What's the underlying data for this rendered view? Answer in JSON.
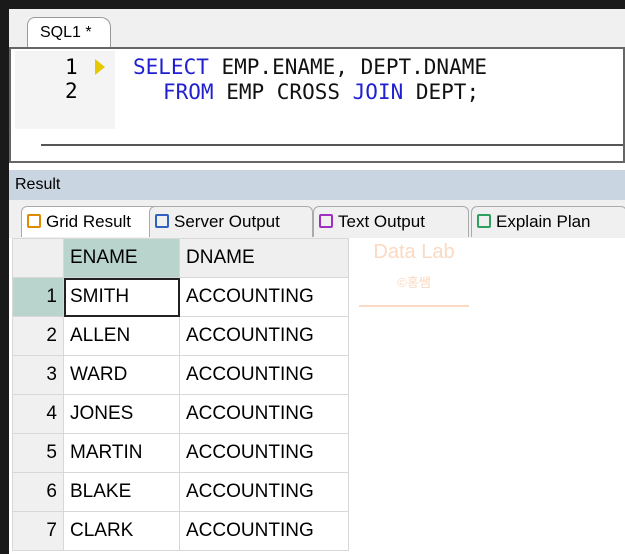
{
  "editor": {
    "tab": "SQL1 *",
    "lines": [
      "1",
      "2"
    ],
    "code": {
      "l1_kw": "SELECT",
      "l1_rest": " EMP.ENAME, DEPT.DNAME",
      "l2_kw1": "FROM",
      "l2_mid": " EMP CROSS ",
      "l2_kw2": "JOIN",
      "l2_rest": " DEPT;"
    }
  },
  "result": {
    "title": "Result",
    "tabs": [
      {
        "label": "Grid Result",
        "icon": "grid-icon",
        "color": "#e08a00"
      },
      {
        "label": "Server Output",
        "icon": "server-output-icon",
        "color": "#3060c0"
      },
      {
        "label": "Text Output",
        "icon": "text-output-icon",
        "color": "#a030c0"
      },
      {
        "label": "Explain Plan",
        "icon": "explain-plan-icon",
        "color": "#30a060"
      }
    ]
  },
  "grid": {
    "columns": [
      "ENAME",
      "DNAME"
    ],
    "rows": [
      [
        "1",
        "SMITH",
        "ACCOUNTING"
      ],
      [
        "2",
        "ALLEN",
        "ACCOUNTING"
      ],
      [
        "3",
        "WARD",
        "ACCOUNTING"
      ],
      [
        "4",
        "JONES",
        "ACCOUNTING"
      ],
      [
        "5",
        "MARTIN",
        "ACCOUNTING"
      ],
      [
        "6",
        "BLAKE",
        "ACCOUNTING"
      ],
      [
        "7",
        "CLARK",
        "ACCOUNTING"
      ]
    ]
  },
  "watermark": {
    "line1": "Data Lab",
    "line2": "©홍쌤"
  }
}
